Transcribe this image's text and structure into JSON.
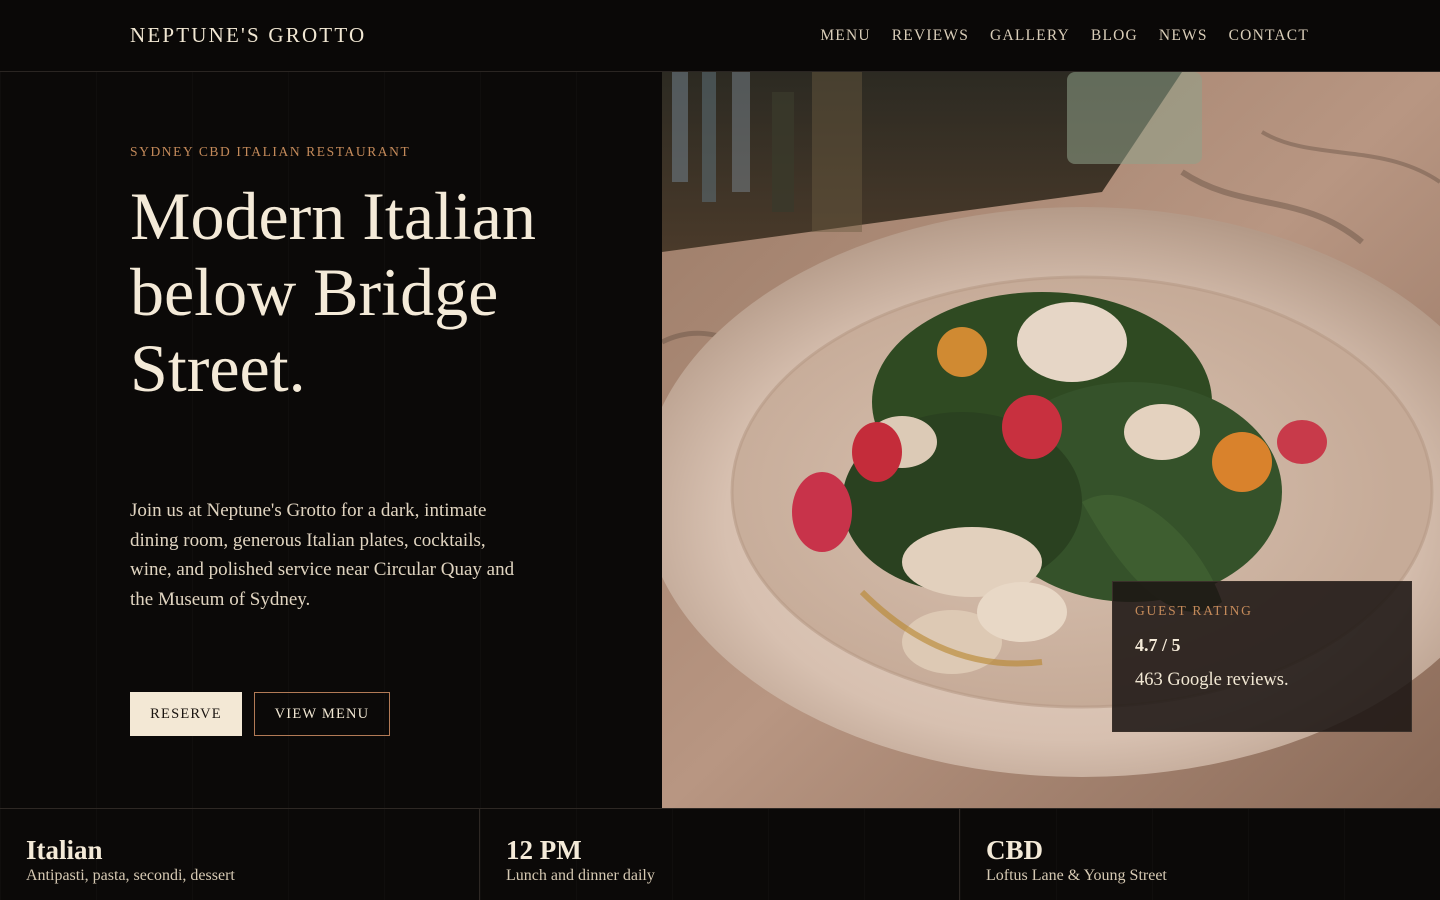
{
  "header": {
    "brand": "NEPTUNE'S GROTTO",
    "nav": [
      "MENU",
      "REVIEWS",
      "GALLERY",
      "BLOG",
      "NEWS",
      "CONTACT"
    ]
  },
  "hero": {
    "eyebrow": "SYDNEY CBD ITALIAN RESTAURANT",
    "headline": "Modern Italian below Bridge Street.",
    "intro": "Join us at Neptune's Grotto for a dark, intimate dining room, generous Italian plates, cocktails, wine, and polished service near Circular Quay and the Museum of Sydney.",
    "reserve_label": "RESERVE",
    "view_menu_label": "VIEW MENU"
  },
  "rating": {
    "label": "GUEST RATING",
    "value": "4.7 / 5",
    "reviews": "463 Google reviews."
  },
  "stats": [
    {
      "title": "Italian",
      "sub": "Antipasti, pasta, secondi, dessert"
    },
    {
      "title": "12 PM",
      "sub": "Lunch and dinner daily"
    },
    {
      "title": "CBD",
      "sub": "Loftus Lane & Young Street"
    }
  ],
  "colors": {
    "background": "#0b0908",
    "accent": "#c48a5a",
    "cream": "#f3e8d5"
  }
}
